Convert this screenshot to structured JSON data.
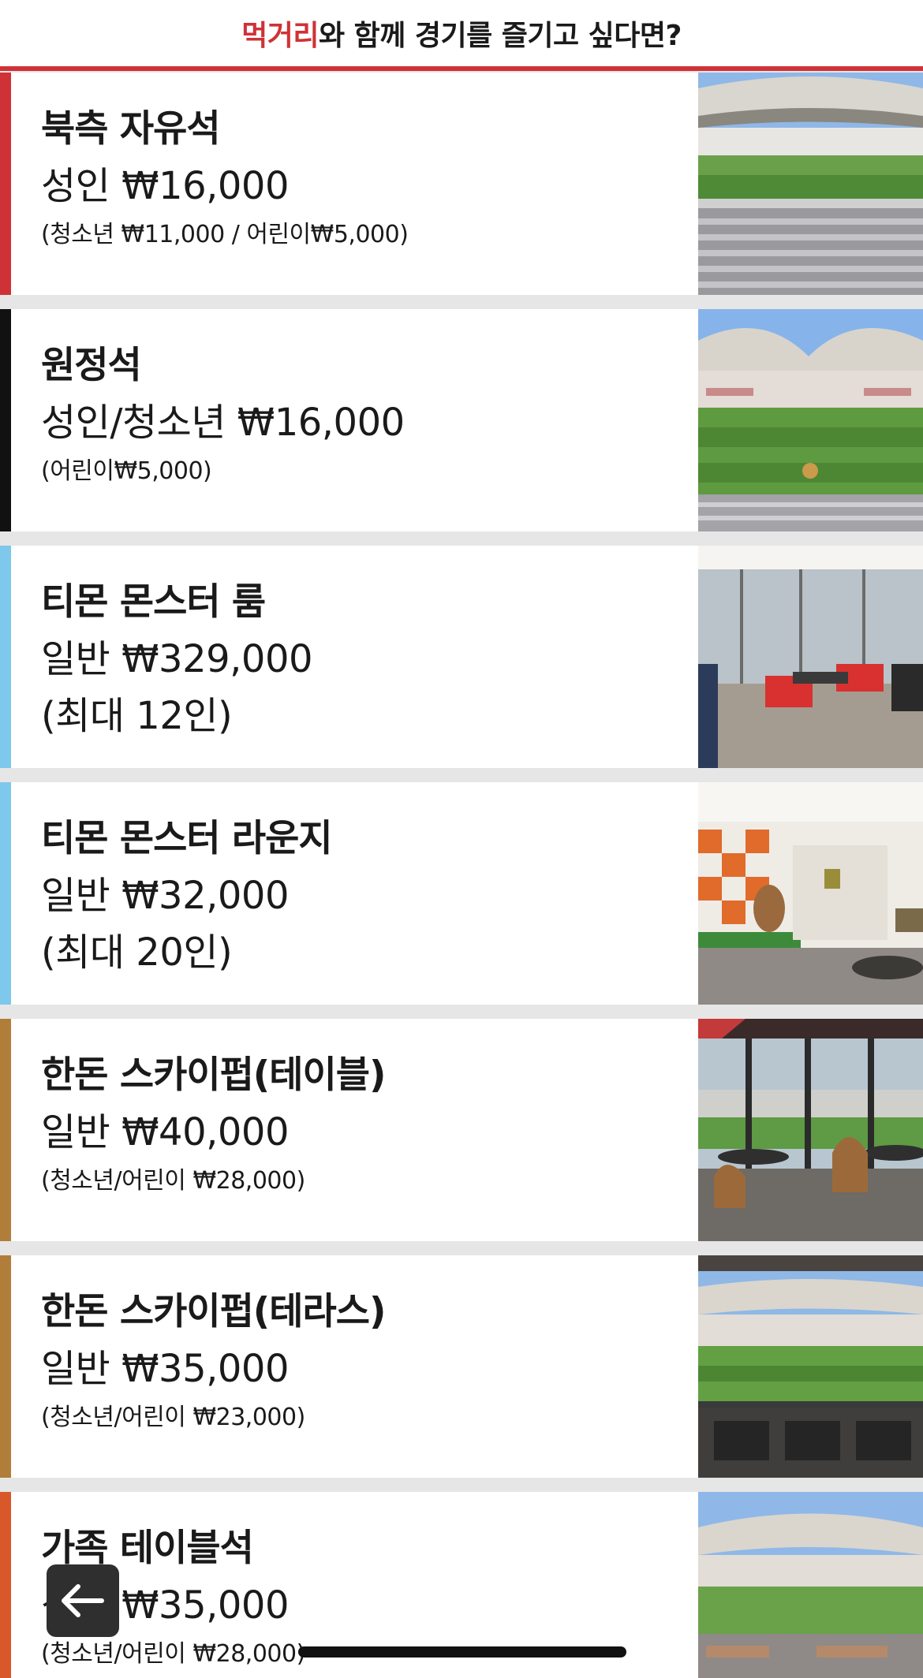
{
  "header": {
    "accent": "먹거리",
    "rest": "와 함께 경기를 즐기고 싶다면?",
    "accent_color": "#cf3236"
  },
  "seats": [
    {
      "name": "북측 자유석",
      "price": "성인 ₩16,000",
      "sub": "(청소년 ₩11,000 / 어린이₩5,000)",
      "stripe_color": "#cf3236",
      "image": "stadium-seats-photo"
    },
    {
      "name": "원정석",
      "price": "성인/청소년 ₩16,000",
      "sub": "(어린이₩5,000)",
      "stripe_color": "#111111",
      "image": "stadium-field-photo"
    },
    {
      "name": "티몬 몬스터 룸",
      "price": "일반 ₩329,000",
      "sub": "(최대 12인)",
      "stripe_color": "#7ec8ec",
      "image": "private-room-photo"
    },
    {
      "name": "티몬 몬스터 라운지",
      "price": "일반 ₩32,000",
      "sub": "(최대 20인)",
      "stripe_color": "#7ec8ec",
      "image": "lounge-photo"
    },
    {
      "name": "한돈 스카이펍(테이블)",
      "price": "일반 ₩40,000",
      "sub": "(청소년/어린이 ₩28,000)",
      "stripe_color": "#b07d3a",
      "image": "skypub-table-photo"
    },
    {
      "name": "한돈 스카이펍(테라스)",
      "price": "일반 ₩35,000",
      "sub": "(청소년/어린이 ₩23,000)",
      "stripe_color": "#b07d3a",
      "image": "skypub-terrace-photo"
    },
    {
      "name": "가족 테이블석",
      "price": "성인 ₩35,000",
      "sub": "(청소년/어린이 ₩28,000)",
      "stripe_color": "#d9582a",
      "image": "family-table-photo"
    }
  ],
  "controls": {
    "back_icon": "arrow-left-icon"
  }
}
